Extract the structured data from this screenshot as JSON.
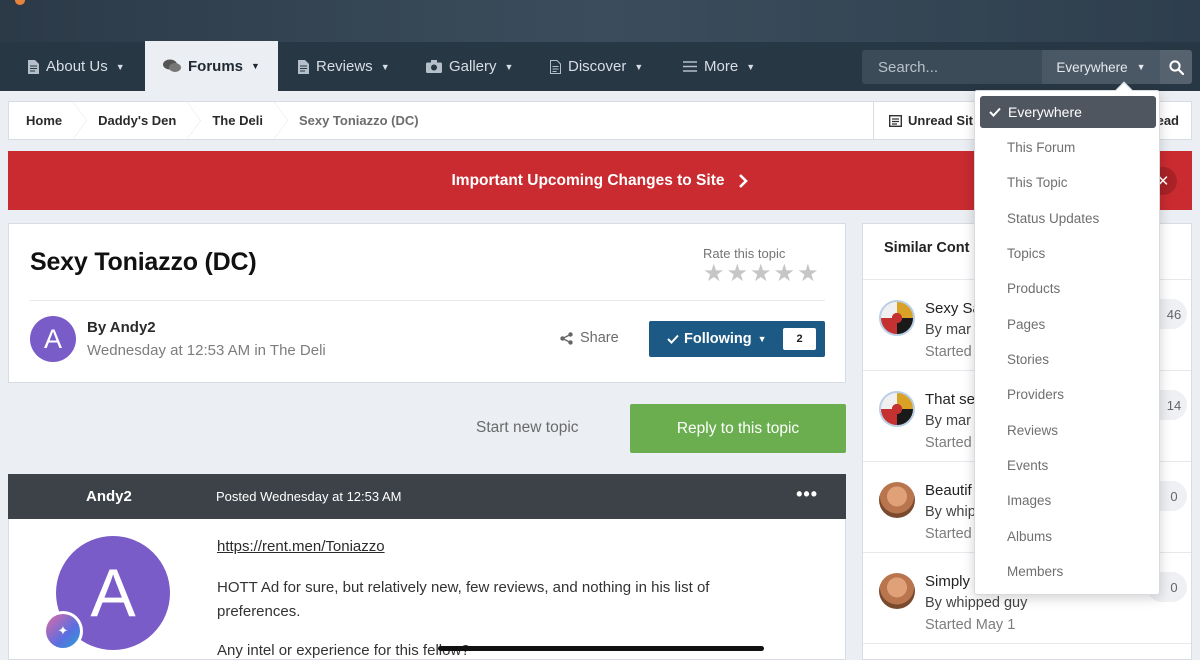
{
  "nav": {
    "items": [
      {
        "label": "About Us",
        "icon": "document-icon"
      },
      {
        "label": "Forums",
        "icon": "chat-bubbles-icon"
      },
      {
        "label": "Reviews",
        "icon": "document-icon"
      },
      {
        "label": "Gallery",
        "icon": "camera-icon"
      },
      {
        "label": "Discover",
        "icon": "document-outline-icon"
      },
      {
        "label": "More",
        "icon": "menu-icon"
      }
    ],
    "active": "Forums"
  },
  "search": {
    "placeholder": "Search...",
    "scope": "Everywhere"
  },
  "breadcrumb": {
    "items": [
      "Home",
      "Daddy's Den",
      "The Deli",
      "Sexy Toniazzo (DC)"
    ],
    "unread_label": "Unread Sit",
    "right_tail": "ead"
  },
  "announcement": {
    "text": "Important Upcoming Changes to Site",
    "close": "✕"
  },
  "topic": {
    "title": "Sexy Toniazzo (DC)",
    "rate_label": "Rate this topic",
    "rating": 0,
    "max_rating": 5,
    "author_initial": "A",
    "author_by": "By Andy2",
    "meta": "Wednesday at 12:53 AM in The Deli",
    "share_label": "Share",
    "following_label": "Following",
    "following_count": "2"
  },
  "actions": {
    "start_topic": "Start new topic",
    "reply": "Reply to this topic"
  },
  "post": {
    "author": "Andy2",
    "date": "Posted Wednesday at 12:53 AM",
    "menu": "•••",
    "avatar_initial": "A",
    "link": "https://rent.men/Toniazzo",
    "text": "HOTT Ad for sure, but relatively new, few reviews, and nothing in his list of preferences.",
    "text2": "Any intel or experience for this fellow?"
  },
  "similar": {
    "title": "Similar Cont",
    "items": [
      {
        "title": "Sexy Sa",
        "by": "By mar",
        "started": "Started",
        "count": "46",
        "avatar": "flag"
      },
      {
        "title": "That se",
        "by": "By mar",
        "started": "Started",
        "count": "14",
        "avatar": "flag"
      },
      {
        "title": "Beautif",
        "by": "By whip",
        "started": "Started",
        "count": "0",
        "avatar": "man"
      },
      {
        "title": "Simply",
        "by": "By whipped guy",
        "started": "Started May 1",
        "count": "0",
        "avatar": "man"
      }
    ]
  },
  "dropdown": {
    "selected": "Everywhere",
    "options": [
      "Everywhere",
      "This Forum",
      "This Topic",
      "Status Updates",
      "Topics",
      "Products",
      "Pages",
      "Stories",
      "Providers",
      "Reviews",
      "Events",
      "Images",
      "Albums",
      "Members"
    ]
  },
  "colors": {
    "nav_bg": "#283744",
    "announce_bg": "#c92b30",
    "follow_bg": "#1c5a85",
    "reply_bg": "#6aae4f",
    "avatar_bg": "#7a5cc8"
  }
}
